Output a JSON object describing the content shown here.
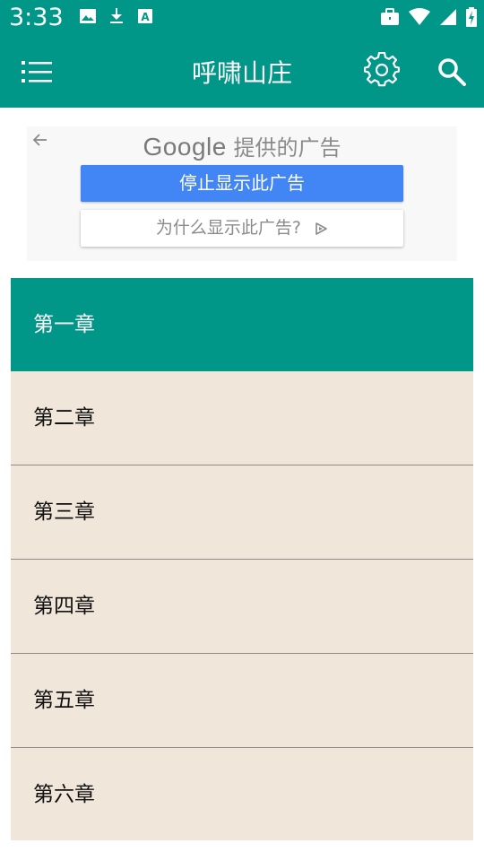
{
  "status_bar": {
    "time": "3:33",
    "left_icons": [
      "image-icon",
      "download-icon",
      "font-icon"
    ],
    "right_icons": [
      "briefcase-icon",
      "wifi-icon",
      "cell-signal-icon",
      "battery-charging-icon"
    ]
  },
  "app_bar": {
    "title": "呼啸山庄",
    "icons": [
      "menu-list-icon",
      "gear-icon",
      "search-icon"
    ],
    "color": "#009688"
  },
  "ad": {
    "brand": "Google",
    "provided_by": "提供的广告",
    "stop_button": "停止显示此广告",
    "why_button": "为什么显示此广告?",
    "stop_button_color": "#4285f4"
  },
  "chapters": {
    "items": [
      {
        "label": "第一章",
        "selected": true
      },
      {
        "label": "第二章",
        "selected": false
      },
      {
        "label": "第三章",
        "selected": false
      },
      {
        "label": "第四章",
        "selected": false
      },
      {
        "label": "第五章",
        "selected": false
      },
      {
        "label": "第六章",
        "selected": false
      }
    ],
    "selected_color": "#009688",
    "item_color": "#f1e6da"
  }
}
